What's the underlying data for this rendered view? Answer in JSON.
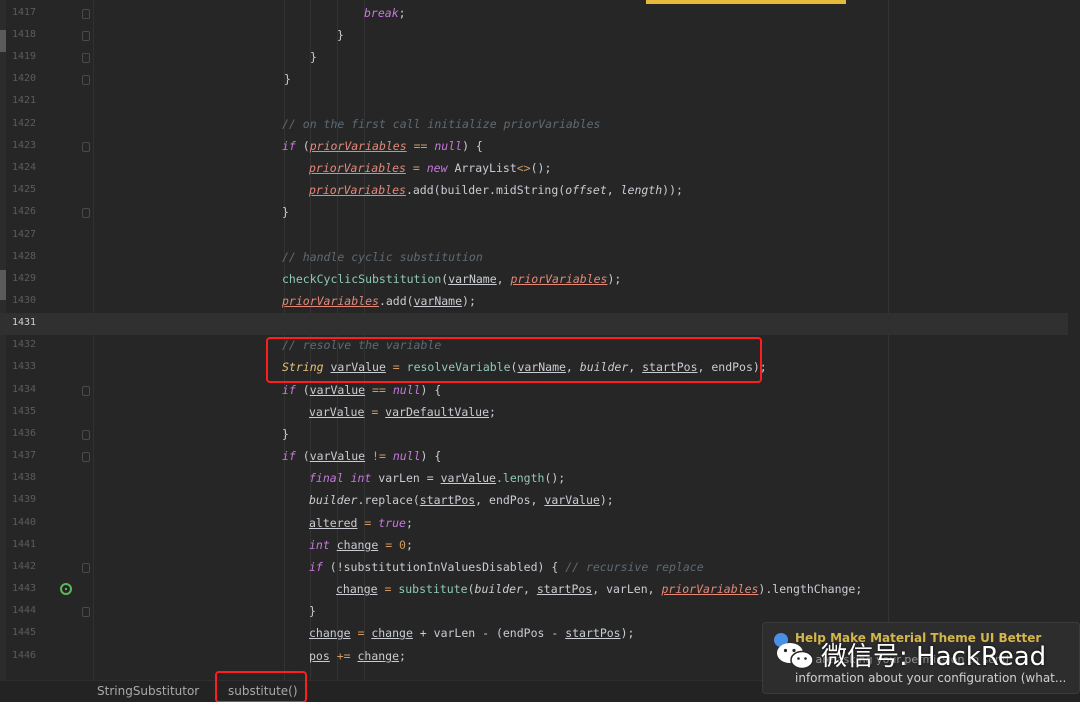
{
  "editor": {
    "current_line": "1431",
    "lines": [
      {
        "n": "1417",
        "fold": true
      },
      {
        "n": "1418",
        "fold": true
      },
      {
        "n": "1419",
        "fold": true
      },
      {
        "n": "1420",
        "fold": true
      },
      {
        "n": "1421"
      },
      {
        "n": "1422"
      },
      {
        "n": "1423",
        "fold": true
      },
      {
        "n": "1424"
      },
      {
        "n": "1425"
      },
      {
        "n": "1426",
        "fold": true
      },
      {
        "n": "1427"
      },
      {
        "n": "1428"
      },
      {
        "n": "1429"
      },
      {
        "n": "1430"
      },
      {
        "n": "1431"
      },
      {
        "n": "1432"
      },
      {
        "n": "1433"
      },
      {
        "n": "1434",
        "fold": true
      },
      {
        "n": "1435"
      },
      {
        "n": "1436",
        "fold": true
      },
      {
        "n": "1437",
        "fold": true
      },
      {
        "n": "1438"
      },
      {
        "n": "1439"
      },
      {
        "n": "1440"
      },
      {
        "n": "1441"
      },
      {
        "n": "1442",
        "fold": true
      },
      {
        "n": "1443",
        "recursive_icon": true
      },
      {
        "n": "1444",
        "fold": true
      },
      {
        "n": "1445"
      },
      {
        "n": "1446"
      }
    ],
    "code": {
      "l1417_break": "break",
      "l1417_semi": ";",
      "brace_close": "}",
      "l1422_comment": "// on the first call initialize priorVariables",
      "if": "if",
      "null": "null",
      "new": "new",
      "String": "String",
      "final": "final",
      "int": "int",
      "true": "true",
      "priorVariables": "priorVariables",
      "l1423_open": " (",
      "l1423_eq": " == ",
      "l1423_close": ") {",
      "l1424_eq": " = ",
      "l1424_type": "ArrayList",
      "l1424_diamond": "<>",
      "l1424_end": "();",
      "l1425_add": ".add(",
      "builder": "builder",
      "l1425_mid": ".midString(",
      "offset": "offset",
      "comma": ", ",
      "length": "length",
      "l1425_end": "));",
      "l1428_comment": "// handle cyclic substitution",
      "l1429_fn": "checkCyclicSubstitution",
      "paren_open": "(",
      "varName": "varName",
      "l1429_end": ");",
      "l1432_comment": "// resolve the variable",
      "varValue": "varValue",
      "l1433_fn": "resolveVariable",
      "startPos": "startPos",
      "l1433_tail": ", endPos);",
      "l1435_eq": " = ",
      "varDefaultValue": "varDefaultValue",
      "semi": ";",
      "l1437_ne": " != ",
      "varLen": " varLen = ",
      "l1438_len": ".length",
      "l1438_end": "();",
      "l1439_rep": ".replace(",
      "l1439_mid": ", endPos, ",
      "l1439_end": ");",
      "altered": "altered",
      "change": "change",
      "zero": "0",
      "l1442_open": " (!substitutionInValuesDisabled) { ",
      "l1442_comment": "// recursive replace",
      "l1443_fn": "substitute",
      "l1443_mid": ", varLen, ",
      "l1443_end": ").lengthChange;",
      "l1445_plus": " + varLen - (endPos - ",
      "l1445_end": ");",
      "pos": "pos",
      "l1446_op": " += ",
      "l1446_end": ";",
      "open_brace": ") {"
    }
  },
  "breadcrumbs": {
    "class": "StringSubstitutor",
    "method": "substitute()"
  },
  "notification": {
    "title": "Help Make Material Theme UI Better",
    "body_line1": "We are asking your permission to send",
    "body_line2": "information about your configuration (what..."
  },
  "watermark": {
    "text": "微信号: HackRead",
    "logo_icon": "wechat-icon"
  },
  "colors": {
    "background": "#262626",
    "keyword": "#c678dd",
    "comment": "#5f6a72",
    "field": "#e4897a",
    "highlight_box": "#ff1e1e",
    "notification_title": "#d4b64b"
  }
}
